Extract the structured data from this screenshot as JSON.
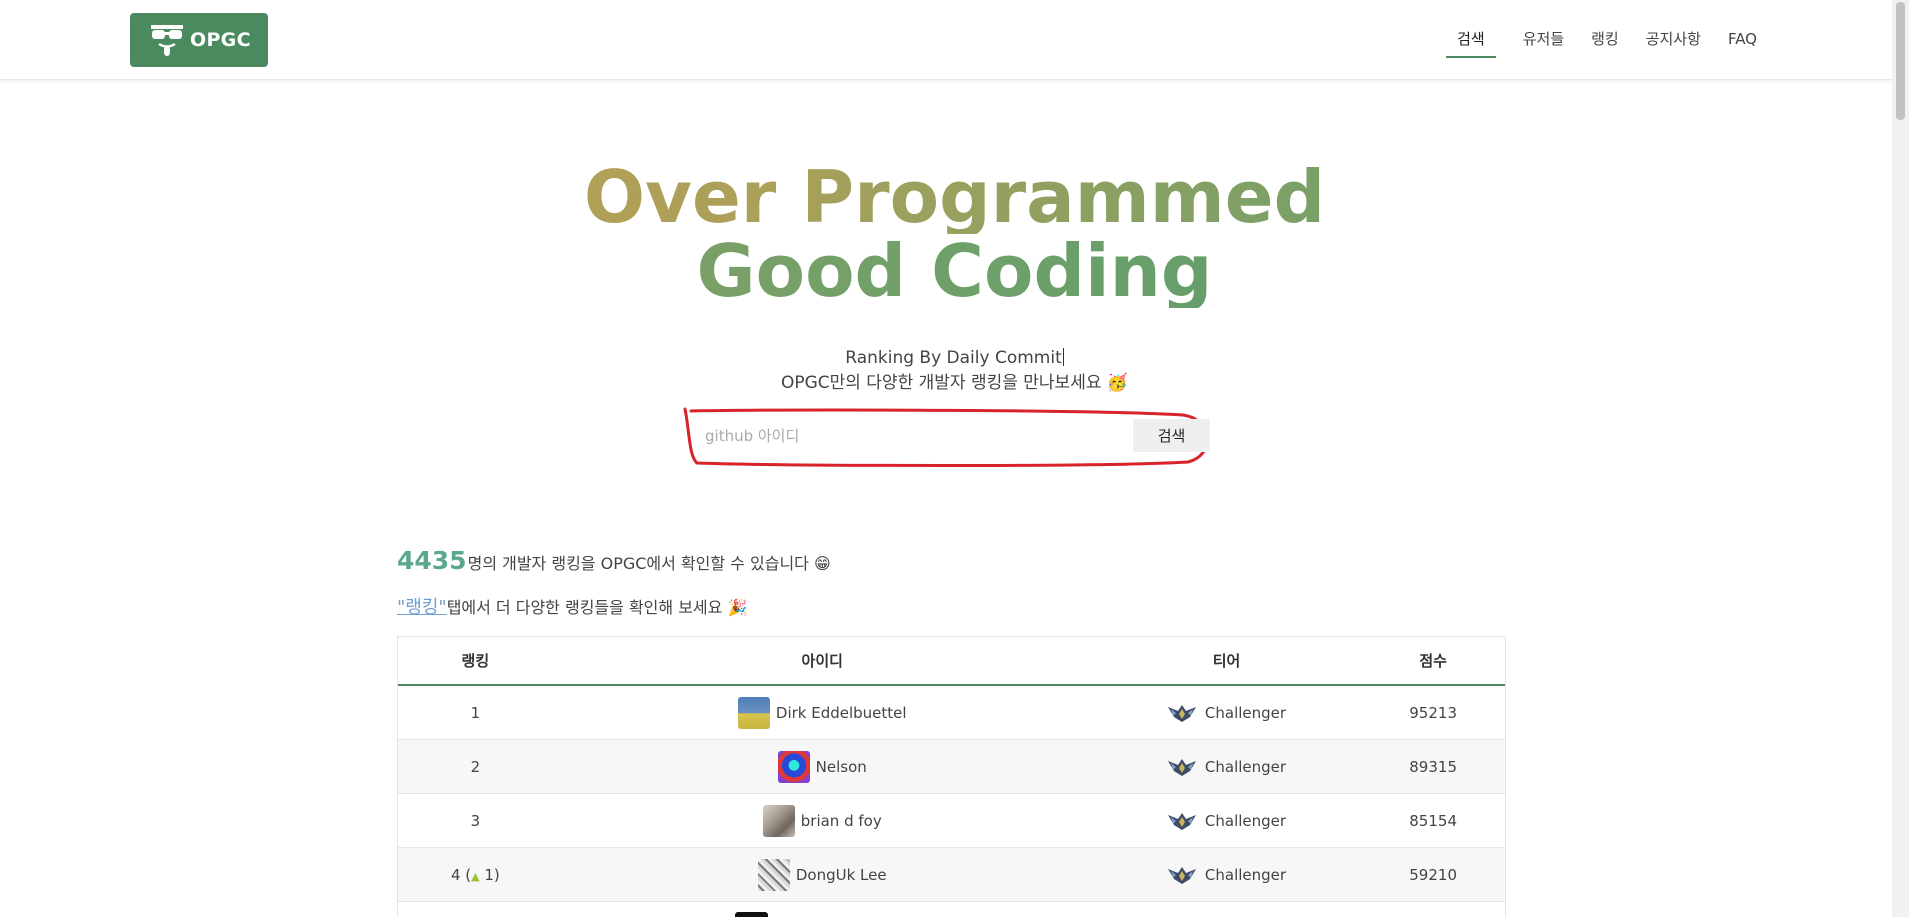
{
  "header": {
    "logo_text": "OPGC",
    "nav": [
      "검색",
      "유저들",
      "랭킹",
      "공지사항",
      "FAQ"
    ]
  },
  "hero": {
    "title_line1": "Over Programmed",
    "title_line2": "Good Coding",
    "subtitle1": "Ranking By Daily Commit",
    "subtitle2": "OPGC만의 다양한 개발자 랭킹을 만나보세요 🥳"
  },
  "search": {
    "placeholder": "github 아이디",
    "value": "",
    "button": "검색"
  },
  "stats": {
    "count": "4435",
    "text": "명의 개발자 랭킹을 OPGC에서 확인할 수 있습니다 😁",
    "link_text": "\"랭킹\"",
    "link_suffix": "탭에서 더 다양한 랭킹들을 확인해 보세요 🎉"
  },
  "table": {
    "headers": [
      "랭킹",
      "아이디",
      "티어",
      "점수"
    ],
    "rows": [
      {
        "rank": "1",
        "change": "",
        "id": "Dirk Eddelbuettel",
        "tier": "Challenger",
        "score": "95213"
      },
      {
        "rank": "2",
        "change": "",
        "id": "Nelson",
        "tier": "Challenger",
        "score": "89315"
      },
      {
        "rank": "3",
        "change": "",
        "id": "brian d foy",
        "tier": "Challenger",
        "score": "85154"
      },
      {
        "rank": "4",
        "change": "1",
        "id": "DongUk Lee",
        "tier": "Challenger",
        "score": "59210"
      }
    ]
  },
  "colors": {
    "brand": "#4a8a5e",
    "accent_count": "#5ba88c",
    "link": "#6f9fd2",
    "annotation": "#d8232a"
  },
  "icons": [
    "glasses-logo-icon",
    "challenger-tier-icon",
    "rank-up-icon"
  ]
}
